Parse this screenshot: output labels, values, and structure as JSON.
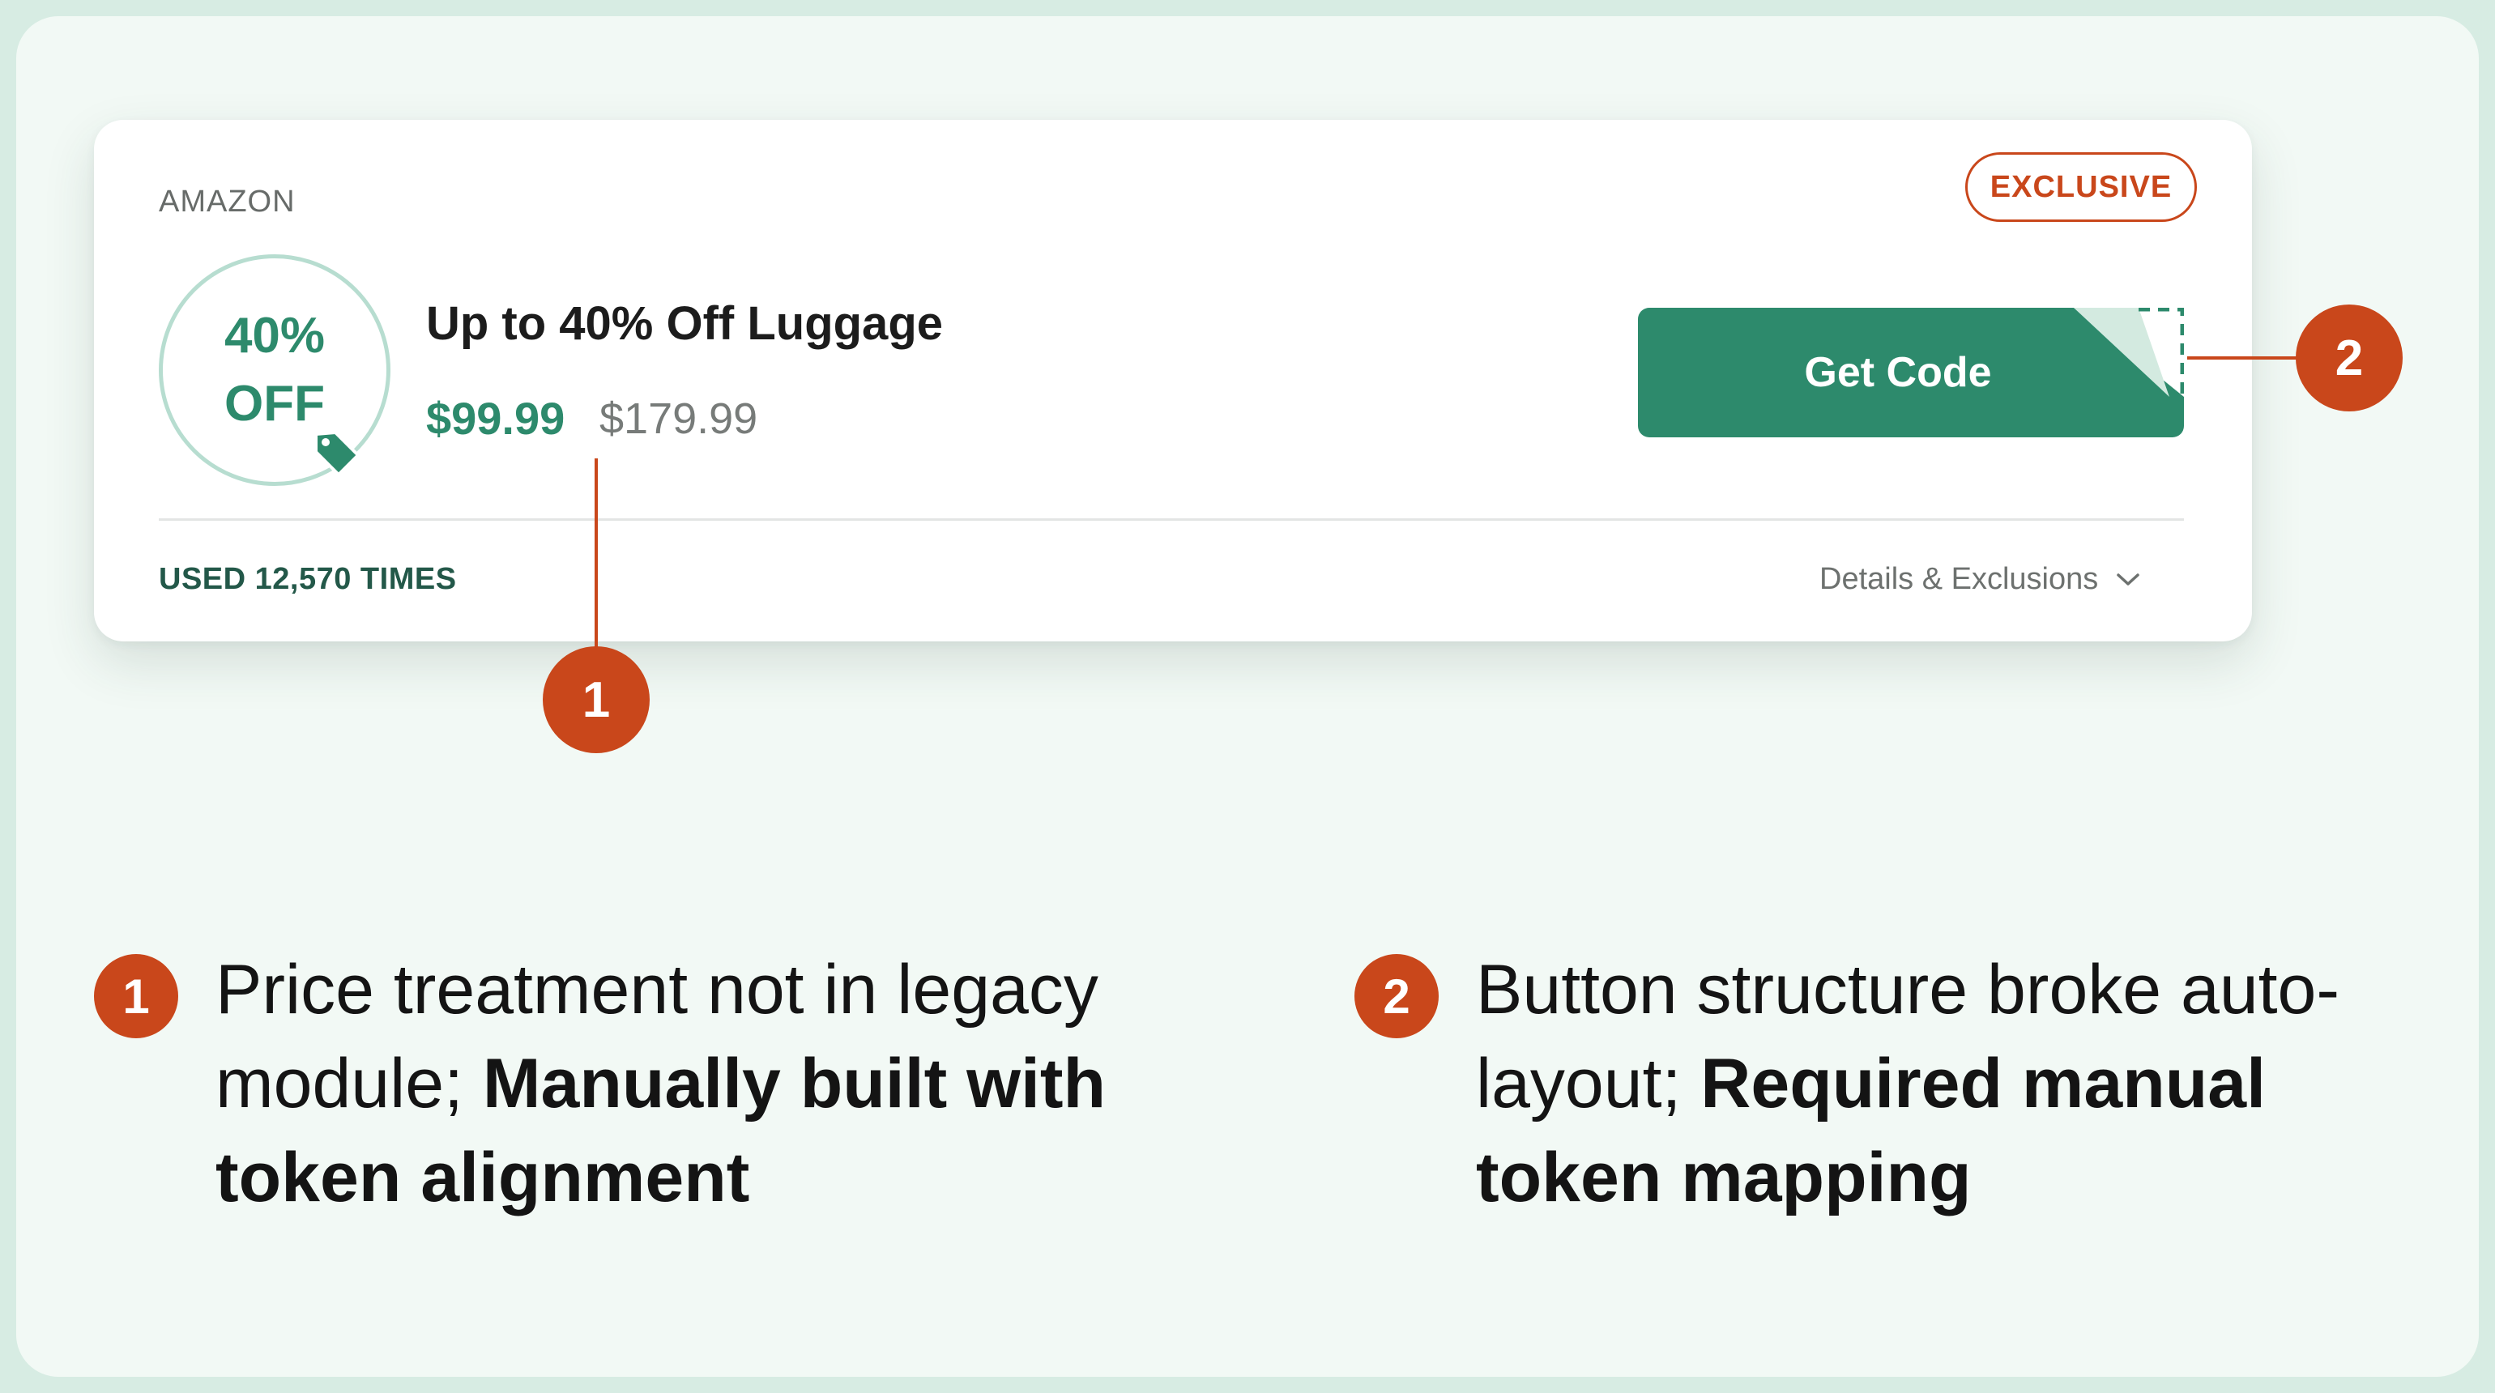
{
  "card": {
    "store": "AMAZON",
    "exclusive_label": "EXCLUSIVE",
    "badge_line1": "40%",
    "badge_line2": "OFF",
    "title": "Up to 40% Off Luggage",
    "price": "$99.99",
    "old_price": "$179.99",
    "button_label": "Get Code",
    "used_text": "USED 12,570 TIMES",
    "details_label": "Details & Exclusions"
  },
  "callouts": [
    "1",
    "2"
  ],
  "notes": [
    {
      "number": "1",
      "line1": "Price treatment not in legacy",
      "line2_normal": "module; ",
      "line2_bold": "Manually built with",
      "line3_bold": "token alignment"
    },
    {
      "number": "2",
      "line1": "Button structure broke auto-",
      "line2_normal": "layout; ",
      "line2_bold": "Required manual",
      "line3_bold": "token mapping"
    }
  ],
  "colors": {
    "brand_green": "#2d8a6c",
    "accent_orange": "#c9471b",
    "background": "#f2f9f5"
  },
  "icons": [
    "price-tag-icon",
    "chevron-down-icon"
  ]
}
